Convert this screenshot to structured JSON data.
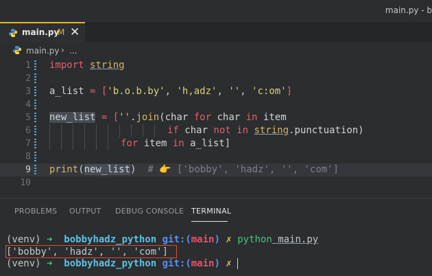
{
  "window": {
    "title": "main.py - b"
  },
  "tab": {
    "filename": "main.py",
    "modified_marker": "M",
    "close_glyph": "✕"
  },
  "breadcrumb": {
    "file": "main.py",
    "separator": "›",
    "rest": "..."
  },
  "editor": {
    "line_numbers": [
      "1",
      "2",
      "3",
      "4",
      "5",
      "6",
      "7",
      "8",
      "9",
      "10"
    ],
    "active_line": 9,
    "l1": {
      "kw": "import",
      "mod": "string"
    },
    "l3": {
      "var": "a_list",
      "op": " = [",
      "s1": "'b.o.b.by'",
      "c1": ", ",
      "s2": "'h,adz'",
      "c2": ", ",
      "s3": "''",
      "c3": ", ",
      "s4": "'c:om'",
      "end": "]"
    },
    "l5": {
      "var": "new_list",
      "op": " = [",
      "str": "''",
      "dot": ".",
      "fn": "join",
      "rest1": "(char ",
      "kw1": "for",
      "rest2": " char ",
      "kw2": "in",
      "rest3": " item"
    },
    "l6": {
      "kw1": "if",
      "rest1": " char ",
      "kw2": "not in",
      "sp": " ",
      "mod": "string",
      "rest2": ".punctuation)"
    },
    "l7": {
      "kw1": "for",
      "rest1": " item ",
      "kw2": "in",
      "rest2": " a_list]"
    },
    "l9": {
      "fn": "print",
      "open": "(",
      "arg": "new_list",
      "close": ")",
      "comment": "  # 👉 ['bobby', 'hadz', '', 'com']"
    }
  },
  "panel": {
    "tabs": [
      "PROBLEMS",
      "OUTPUT",
      "DEBUG CONSOLE",
      "TERMINAL"
    ],
    "active_tab": "TERMINAL"
  },
  "terminal": {
    "prompt1": {
      "env": "(venv) ",
      "arrow": "➜ ",
      "path": " bobbyhadz_python",
      "git": " git:(",
      "branch": "main",
      "gitclose": ")",
      "x": " ✗ ",
      "cmd": "python",
      "arg": " main.py"
    },
    "output": "['bobby', 'hadz', '', 'com']",
    "prompt2": {
      "env": "(venv) ",
      "arrow": "➜ ",
      "path": " bobbyhadz_python",
      "git": " git:(",
      "branch": "main",
      "gitclose": ")",
      "x": " ✗ "
    }
  },
  "colors": {
    "accent_tab_border": "#f0b429",
    "highlight_box": "#dd4a3a"
  }
}
